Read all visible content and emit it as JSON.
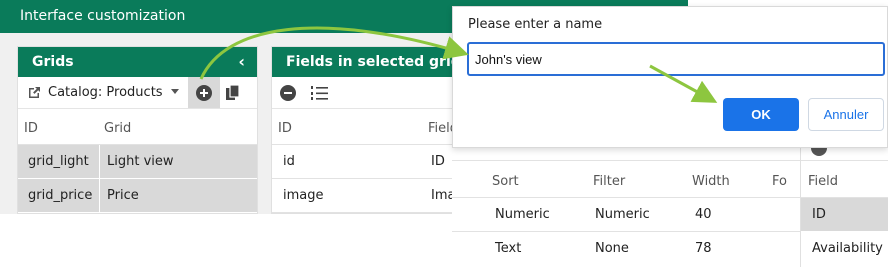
{
  "app": {
    "title": "Interface customization"
  },
  "grids_panel": {
    "title": "Grids",
    "collapse_icon": "chevron-left-icon",
    "catalog_select": "Catalog: Products",
    "columns": [
      "ID",
      "Grid"
    ],
    "rows": [
      {
        "id": "grid_light",
        "name": "Light view"
      },
      {
        "id": "grid_price",
        "name": "Price"
      }
    ]
  },
  "fields_panel": {
    "title": "Fields in selected grid",
    "columns": [
      "ID",
      "Field"
    ],
    "rows": [
      {
        "id": "id",
        "field": "ID"
      },
      {
        "id": "image",
        "field": "Image"
      }
    ]
  },
  "dialog": {
    "title": "Please enter a name",
    "input_value": "John's view",
    "ok_label": "OK",
    "cancel_label": "Annuler"
  },
  "fields_detail": {
    "columns": [
      "Sort",
      "Filter",
      "Width",
      "Fo"
    ],
    "rows": [
      {
        "sort": "Numeric",
        "filter": "Numeric",
        "width": "40"
      },
      {
        "sort": "Text",
        "filter": "None",
        "width": "78"
      }
    ]
  },
  "field_list": {
    "header": "Field",
    "rows": [
      "ID",
      "Availability"
    ]
  },
  "colors": {
    "header_green": "#0a7b5a",
    "ok_blue": "#1a73e8",
    "selected_row": "#d9d9d9",
    "arrow_green": "#8dc63f"
  }
}
